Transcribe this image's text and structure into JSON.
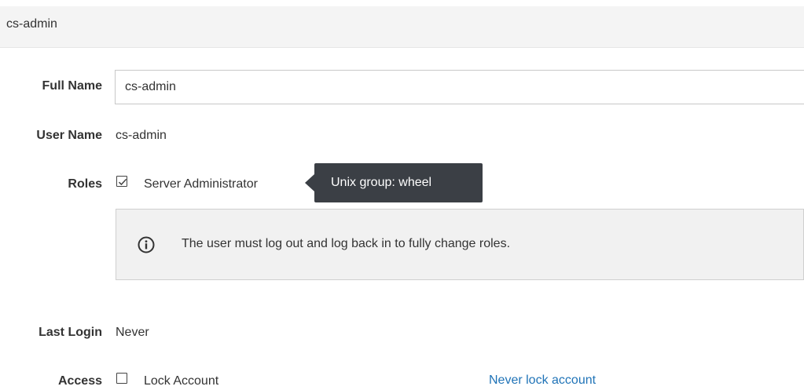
{
  "header": {
    "title": "cs-admin"
  },
  "form": {
    "full_name": {
      "label": "Full Name",
      "value": "cs-admin"
    },
    "user_name": {
      "label": "User Name",
      "value": "cs-admin"
    },
    "roles": {
      "label": "Roles",
      "options": [
        {
          "label": "Server Administrator",
          "checked": true
        }
      ],
      "tooltip": "Unix group: wheel"
    },
    "info": {
      "message": "The user must log out and log back in to fully change roles."
    },
    "last_login": {
      "label": "Last Login",
      "value": "Never"
    },
    "access": {
      "label": "Access",
      "checkbox_label": "Lock Account",
      "checked": false,
      "link_label": "Never lock account"
    }
  },
  "colors": {
    "header_bg": "#f4f4f4",
    "tooltip_bg": "#3b3f45",
    "info_bg": "#f1f1f1",
    "link": "#1f73b7"
  },
  "icons": {
    "info": "info-circle-icon",
    "check": "checkmark-icon"
  }
}
